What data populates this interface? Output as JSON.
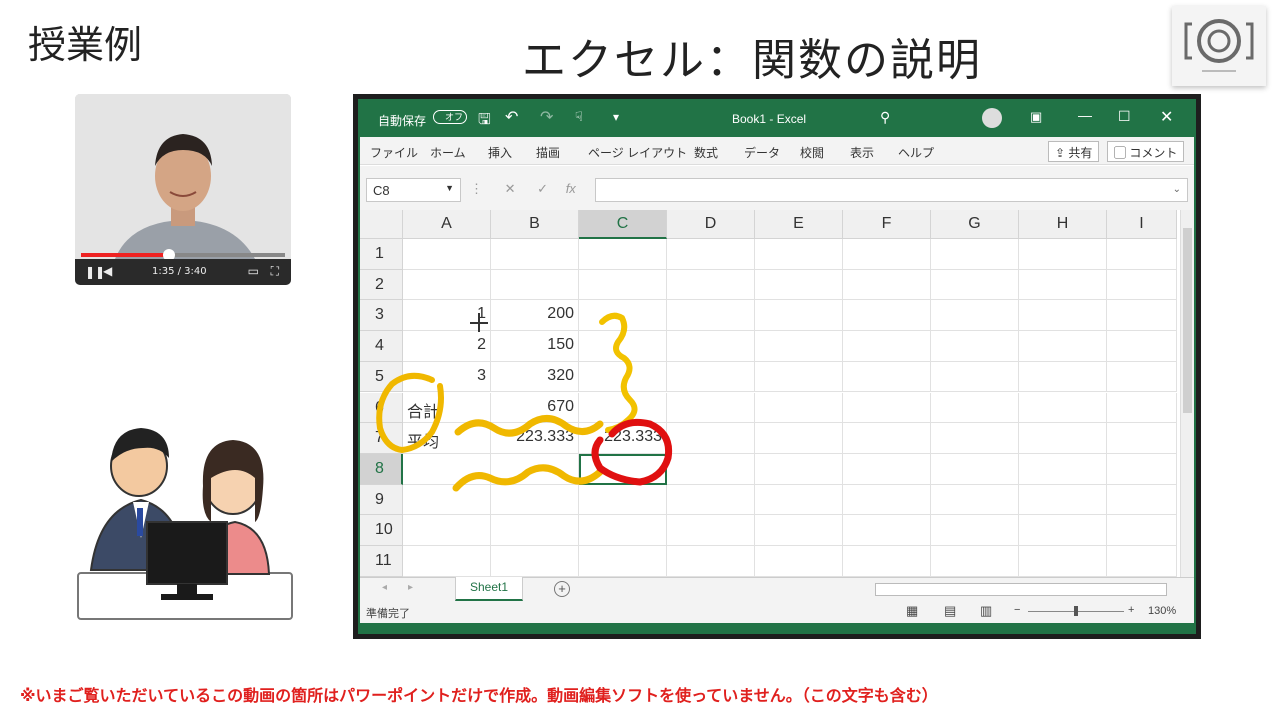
{
  "slide": {
    "label": "授業例",
    "title": "エクセル：関数の説明",
    "footer_note": "※いまご覧いただいているこの動画の箇所はパワーポイントだけで作成。動画編集ソフトを使っていません。（この文字も含む）"
  },
  "video_player": {
    "time": "1:35 / 3:40",
    "progress": 0.43
  },
  "excel": {
    "autosave_label": "自動保存",
    "autosave_state": "オフ",
    "window_title": "Book1  -  Excel",
    "ribbon_tabs": [
      "ファイル",
      "ホーム",
      "挿入",
      "描画",
      "ページ レイアウト",
      "数式",
      "データ",
      "校閲",
      "表示",
      "ヘルプ"
    ],
    "share_label": "共有",
    "comment_label": "コメント",
    "name_box": "C8",
    "formula": "",
    "columns": [
      "A",
      "B",
      "C",
      "D",
      "E",
      "F",
      "G",
      "H",
      "I"
    ],
    "selected_column": "C",
    "rows": [
      {
        "num": "1",
        "cells": [
          "",
          "",
          ""
        ]
      },
      {
        "num": "2",
        "cells": [
          "",
          "",
          ""
        ]
      },
      {
        "num": "3",
        "cells": [
          "1",
          "200",
          ""
        ]
      },
      {
        "num": "4",
        "cells": [
          "2",
          "150",
          ""
        ]
      },
      {
        "num": "5",
        "cells": [
          "3",
          "320",
          ""
        ]
      },
      {
        "num": "6",
        "cells": [
          "合計",
          "670",
          ""
        ]
      },
      {
        "num": "7",
        "cells": [
          "平均",
          "223.333",
          "223.333"
        ]
      },
      {
        "num": "8",
        "cells": [
          "",
          "",
          ""
        ]
      },
      {
        "num": "9",
        "cells": [
          "",
          "",
          ""
        ]
      },
      {
        "num": "10",
        "cells": [
          "",
          "",
          ""
        ]
      },
      {
        "num": "11",
        "cells": [
          "",
          "",
          ""
        ]
      }
    ],
    "selected_row": "8",
    "sheet_tab": "Sheet1",
    "status_text": "準備完了",
    "zoom": "130%"
  },
  "colors": {
    "excel_green": "#217346",
    "annotation_yellow": "#f2c200",
    "annotation_red": "#e01010",
    "note_red": "#e0201e"
  }
}
